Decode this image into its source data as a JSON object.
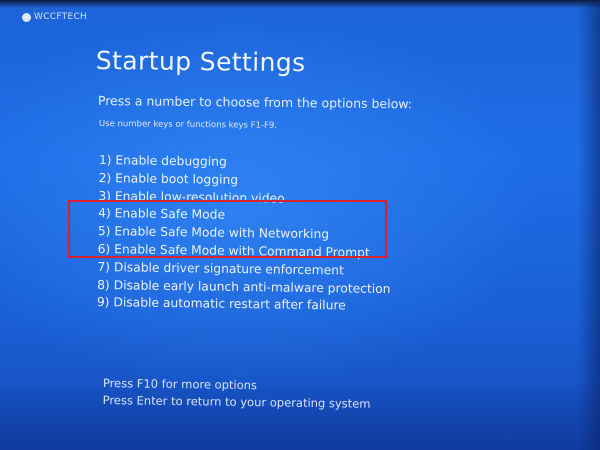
{
  "watermark": "WCCFTECH",
  "title": "Startup Settings",
  "subtitle": "Press a number to choose from the options below:",
  "hint": "Use number keys or functions keys F1-F9.",
  "options": [
    "1) Enable debugging",
    "2) Enable boot logging",
    "3) Enable low-resolution video",
    "4) Enable Safe Mode",
    "5) Enable Safe Mode with Networking",
    "6) Enable Safe Mode with Command Prompt",
    "7) Disable driver signature enforcement",
    "8) Disable early launch anti-malware protection",
    "9) Disable automatic restart after failure"
  ],
  "footer": {
    "more_options": "Press F10 for more options",
    "return": "Press Enter to return to your operating system"
  },
  "colors": {
    "background": "#1e6de6",
    "text": "#eaf1ff",
    "highlight_border": "#d8232e"
  }
}
